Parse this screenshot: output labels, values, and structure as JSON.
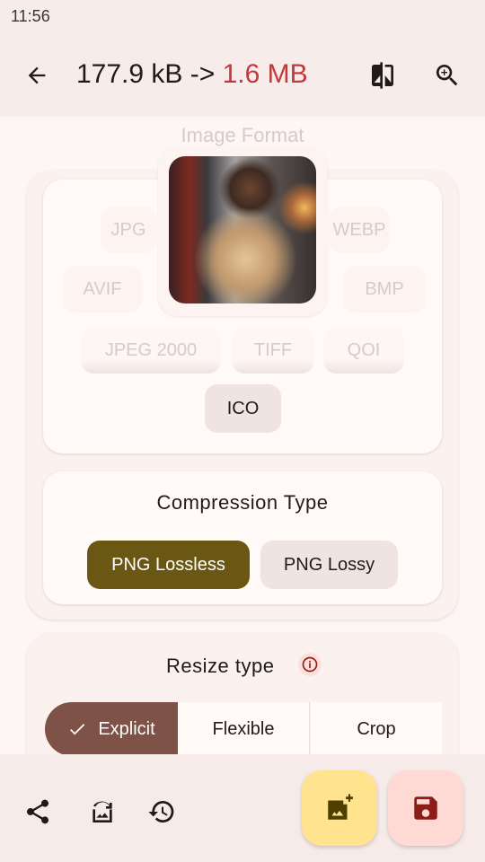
{
  "status_bar": {
    "time": "11:56"
  },
  "topbar": {
    "original_size": "177.9 kB",
    "arrow": " -> ",
    "new_size": "1.6 MB",
    "new_size_color": "#c2383c"
  },
  "image_format": {
    "title": "Image Format",
    "chips": [
      {
        "label": "JPG"
      },
      {
        "label": "WEBP"
      },
      {
        "label": "AVIF"
      },
      {
        "label": "BMP"
      },
      {
        "label": "JPEG 2000"
      },
      {
        "label": "TIFF"
      },
      {
        "label": "QOI"
      },
      {
        "label": "ICO",
        "selected": true
      }
    ]
  },
  "compression": {
    "title": "Compression Type",
    "options": [
      {
        "label": "PNG Lossless",
        "selected": true,
        "color": "#6b5714"
      },
      {
        "label": "PNG Lossy",
        "selected": false
      }
    ]
  },
  "resize": {
    "title": "Resize type",
    "options": [
      {
        "label": "Explicit",
        "selected": true,
        "color": "#7f5247"
      },
      {
        "label": "Flexible"
      },
      {
        "label": "Crop"
      }
    ]
  },
  "bottom": {
    "icons": [
      "share-icon",
      "edit-image-icon",
      "history-icon"
    ],
    "add_image_color": "#ffe38e",
    "save_color": "#ffdad5"
  }
}
